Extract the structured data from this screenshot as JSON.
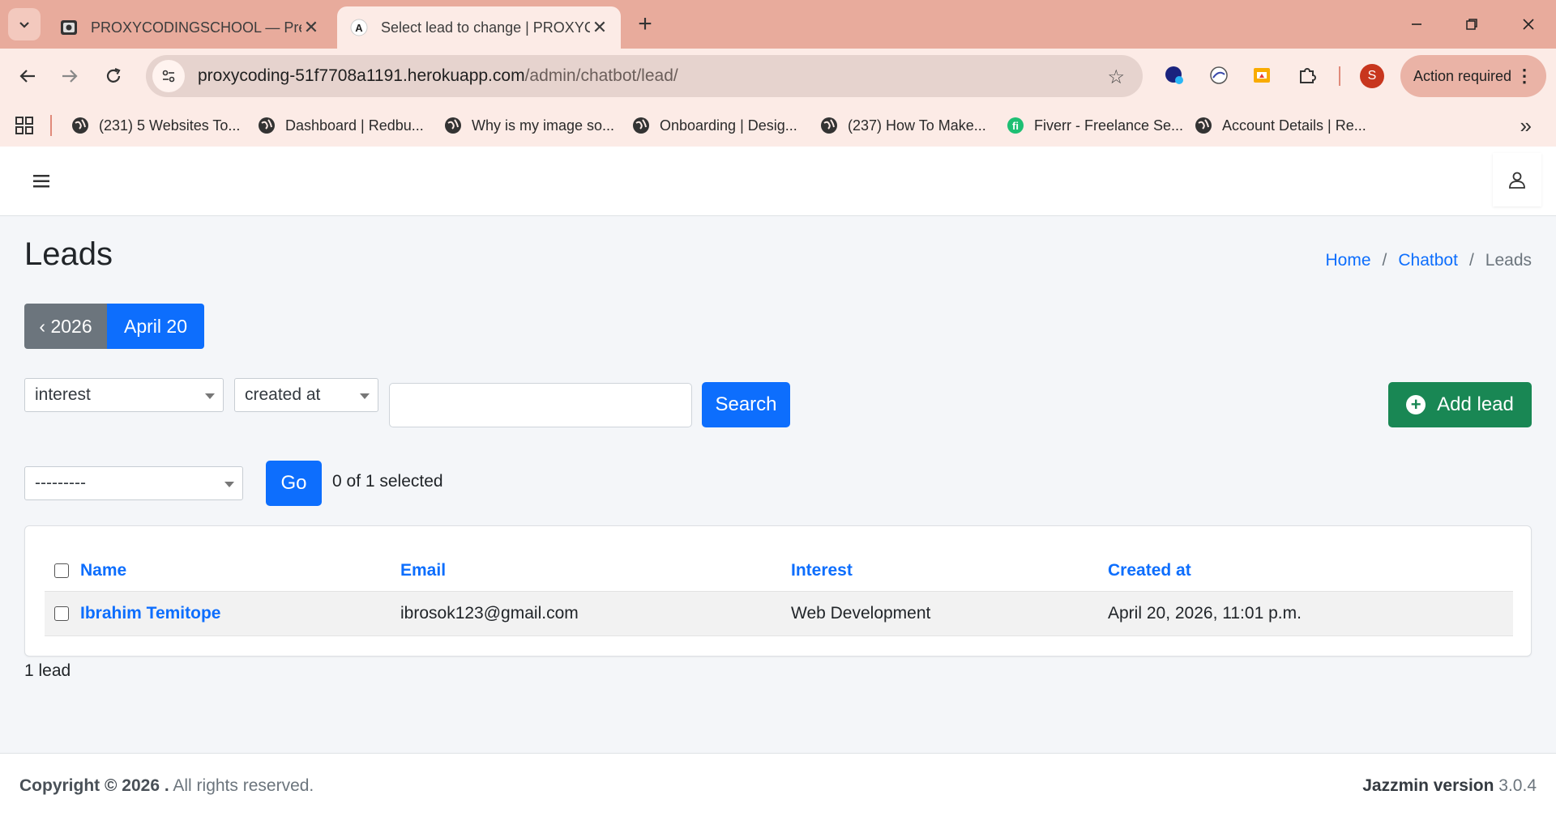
{
  "browser": {
    "tabs": [
      {
        "title": "PROXYCODINGSCHOOL — Premium Coding School",
        "active": false
      },
      {
        "title": "Select lead to change | PROXYCODING",
        "active": true
      }
    ],
    "address": {
      "host": "proxycoding-51f7708a1191.herokuapp.com",
      "path": "/admin/chatbot/lead/"
    },
    "profile_initial": "S",
    "action_required": "Action required",
    "bookmarks": [
      "(231) 5 Websites To...",
      "Dashboard | Redbu...",
      "Why is my image so...",
      "Onboarding | Desig...",
      "(237) How To Make...",
      "Fiverr - Freelance Se...",
      "Account Details | Re..."
    ],
    "colors": {
      "tabstrip": "#e8ab9c",
      "toolbar": "#fcebe6",
      "fiverr": "#1dbf73"
    }
  },
  "page": {
    "title": "Leads",
    "breadcrumb": {
      "home": "Home",
      "chatbot": "Chatbot",
      "current": "Leads",
      "separator": "/"
    },
    "date_hierarchy": {
      "prev": "‹ 2026",
      "current": "April 20"
    },
    "filters": {
      "interest": "interest",
      "created_at": "created at"
    },
    "search": {
      "value": "",
      "button": "Search"
    },
    "add_button": "Add lead",
    "action": {
      "select_value": "---------",
      "go": "Go",
      "selected_text": "0 of 1 selected"
    },
    "table": {
      "headers": {
        "name": "Name",
        "email": "Email",
        "interest": "Interest",
        "created_at": "Created at"
      },
      "rows": [
        {
          "name": "Ibrahim Temitope",
          "email": "ibrosok123@gmail.com",
          "interest": "Web Development",
          "created_at": "April 20, 2026, 11:01 p.m."
        }
      ]
    },
    "result_count": "1 lead",
    "footer": {
      "copyright_bold": "Copyright © 2026 .",
      "copyright_rest": " All rights reserved.",
      "version_label": "Jazzmin version",
      "version": " 3.0.4"
    },
    "colors": {
      "primary": "#0d6efd",
      "success": "#198754",
      "secondary": "#6c757d"
    }
  }
}
